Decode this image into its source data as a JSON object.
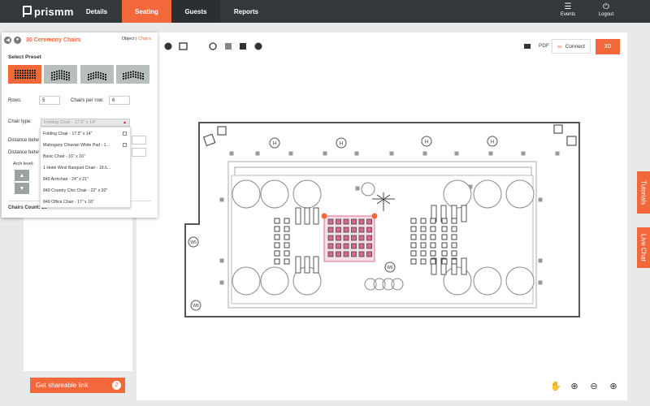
{
  "app": {
    "brand": "prismm"
  },
  "nav": {
    "tabs": [
      {
        "label": "Details"
      },
      {
        "label": "Seating"
      },
      {
        "label": "Guests"
      },
      {
        "label": "Reports"
      }
    ],
    "events_label": "Events",
    "logout_label": "Logout"
  },
  "panel": {
    "title": "30 Ceremony Chairs",
    "toggle_object": "Object",
    "toggle_chairs": "Chairs",
    "select_preset_label": "Select Preset",
    "rows_label": "Rows:",
    "rows_value": "5",
    "chairs_per_row_label": "Chairs per row:",
    "chairs_per_row_value": "6",
    "chair_type_label": "Chair type:",
    "chair_type_selected": "Folding Chair - 17.5\" x 14\"",
    "distance_label_1": "Distance betw",
    "distance_label_2": "Distance betw",
    "arch_level_label": "Arch level:",
    "chairs_count_label": "Chairs Count: 30",
    "dropdown_options": [
      "Folding Chair - 17.5\" x 14\"",
      "Mahogany Chiavari White Pad - 1...",
      "Basic Chair - 16\" x 16\"",
      "1 Hotel West Banquet Chair - 18.6...",
      "849 Armchair - 24\" x 21\"",
      "849 Country Chic Chair - 22\" x 20\"",
      "849 Office Chair - 17\" x 18\""
    ]
  },
  "share": {
    "label": "Get shareable link",
    "count": "2"
  },
  "toolbar": {
    "pdf_label": "PDF",
    "connect_label": "Connect",
    "view3d_label": "3D"
  },
  "side_tabs": {
    "tutorials": "Tutorials",
    "live_chat": "Live Chat"
  },
  "floorplan": {
    "h_labels": [
      "H",
      "H",
      "H",
      "H"
    ],
    "w_labels": [
      "W5",
      "W8",
      "W6"
    ]
  },
  "colors": {
    "accent": "#f2683a",
    "topbar": "#33383c",
    "selected_chairs": "#e8a0b8"
  }
}
